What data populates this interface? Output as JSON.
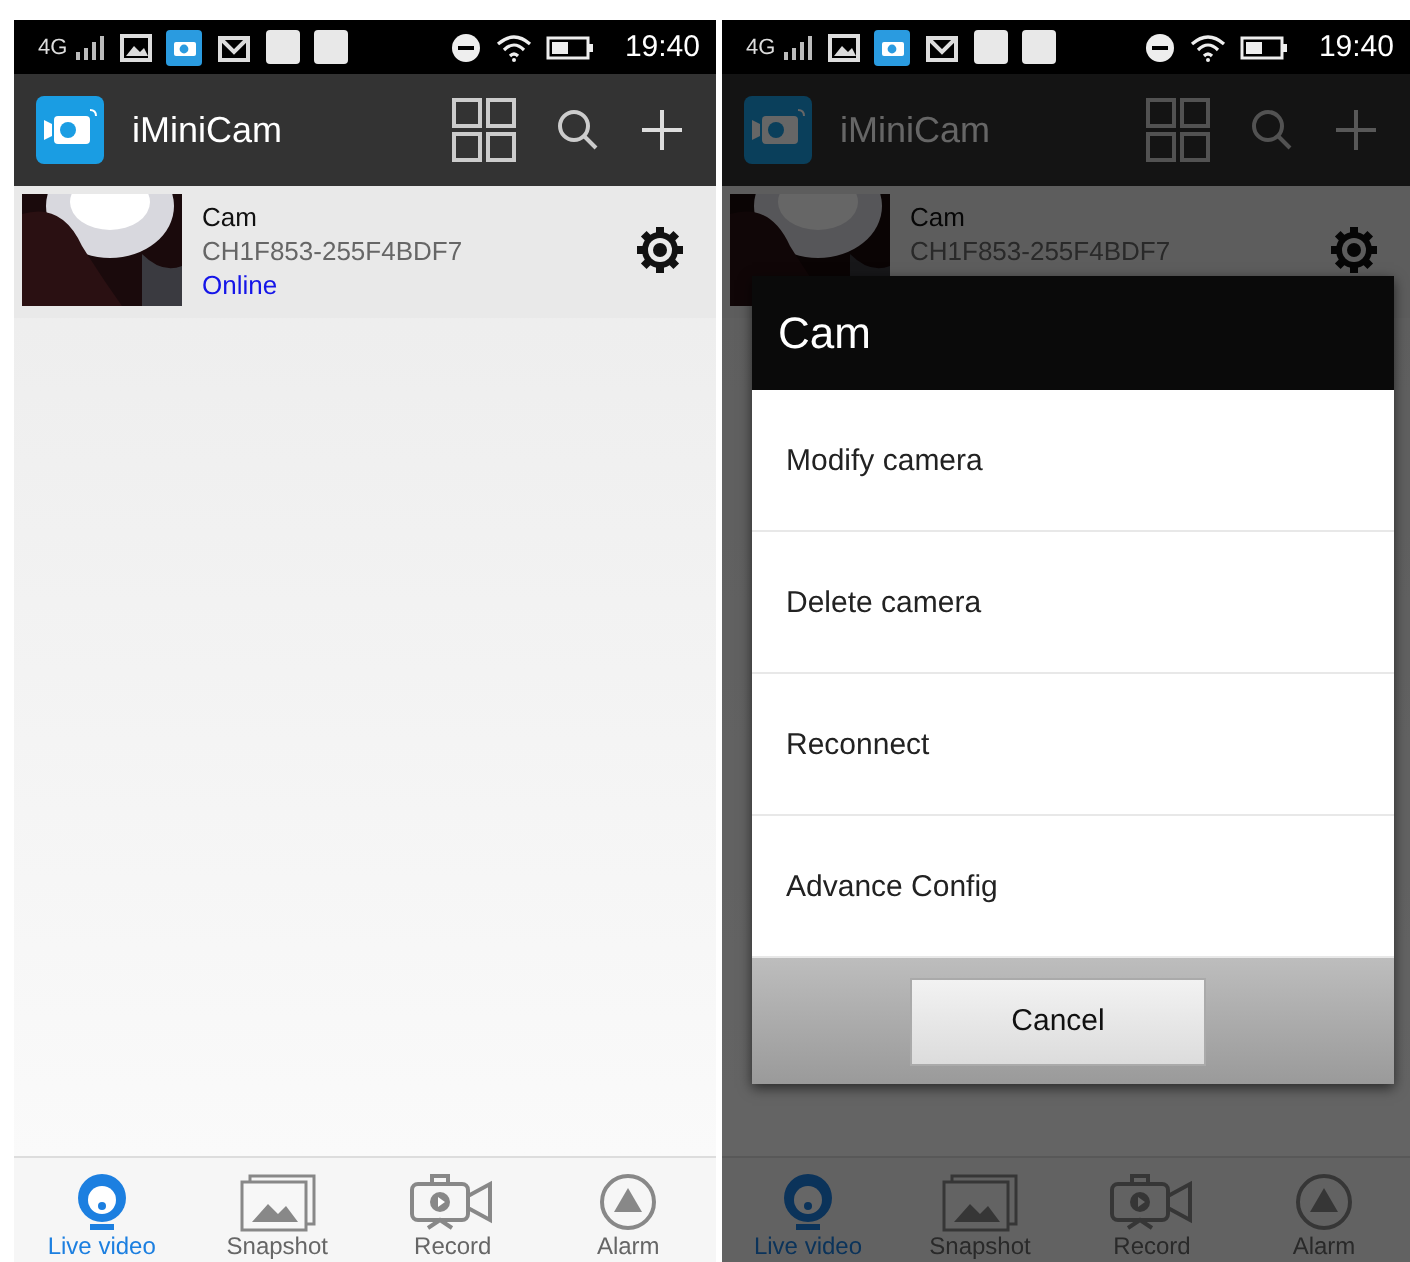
{
  "screens": [
    {
      "status_bar": {
        "network": "4G",
        "time": "19:40"
      },
      "app_bar": {
        "title": "iMiniCam"
      },
      "cameras": [
        {
          "name": "Cam",
          "id": "CH1F853-255F4BDF7",
          "status": "Online"
        }
      ],
      "nav": [
        {
          "kind": "live",
          "label": "Live video",
          "selected": true
        },
        {
          "kind": "snapshot",
          "label": "Snapshot",
          "selected": false
        },
        {
          "kind": "record",
          "label": "Record",
          "selected": false
        },
        {
          "kind": "alarm",
          "label": "Alarm",
          "selected": false
        }
      ]
    },
    {
      "status_bar": {
        "network": "4G",
        "time": "19:40"
      },
      "app_bar": {
        "title": "iMiniCam"
      },
      "cameras": [
        {
          "name": "Cam",
          "id": "CH1F853-255F4BDF7"
        }
      ],
      "nav": [
        {
          "kind": "live",
          "label": "Live video",
          "selected": true
        },
        {
          "kind": "snapshot",
          "label": "Snapshot",
          "selected": false
        },
        {
          "kind": "record",
          "label": "Record",
          "selected": false
        },
        {
          "kind": "alarm",
          "label": "Alarm",
          "selected": false
        }
      ],
      "dialog": {
        "title": "Cam",
        "options": [
          "Modify camera",
          "Delete camera",
          "Reconnect",
          "Advance Config"
        ],
        "cancel": "Cancel"
      }
    }
  ]
}
